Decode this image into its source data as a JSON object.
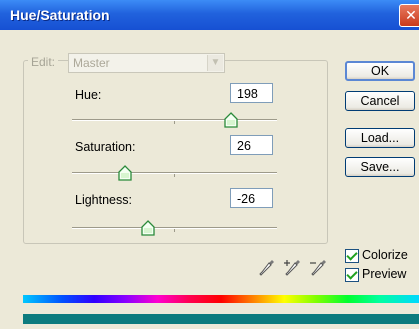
{
  "window": {
    "title": "Hue/Saturation",
    "close_symbol": "✕"
  },
  "edit": {
    "label": "Edit:",
    "value": "Master"
  },
  "hue": {
    "label": "Hue:",
    "value": "198",
    "slider_fraction": 0.775
  },
  "saturation": {
    "label": "Saturation:",
    "value": "26",
    "slider_fraction": 0.26
  },
  "lightness": {
    "label": "Lightness:",
    "value": "-26",
    "slider_fraction": 0.37
  },
  "buttons": {
    "ok": "OK",
    "cancel": "Cancel",
    "load": "Load...",
    "save": "Save..."
  },
  "options": {
    "colorize": "Colorize",
    "preview": "Preview",
    "colorize_checked": true,
    "preview_checked": true
  },
  "colors": {
    "result_bar": "#0c7b7e",
    "titlebar": "#1f5fdc"
  }
}
